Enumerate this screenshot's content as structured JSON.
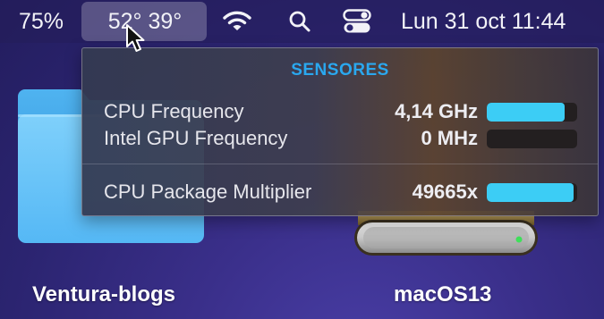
{
  "menubar": {
    "battery_percent": "75%",
    "temperatures": "52° 39°",
    "icons": {
      "wifi": "wifi-icon",
      "search": "search-icon",
      "control_center": "control-center-icon"
    },
    "clock": "Lun 31 oct 11:44"
  },
  "popover": {
    "title": "SENSORES",
    "accent_color": "#2aa8ef",
    "bar_color": "#3ccdf5",
    "sensors": [
      {
        "name": "CPU Frequency",
        "value": "4,14 GHz",
        "level": 0.86
      },
      {
        "name": "Intel GPU Frequency",
        "value": "0 MHz",
        "level": 0.0
      },
      {
        "name": "CPU Package Multiplier",
        "value": "49665x",
        "level": 0.96
      }
    ]
  },
  "desktop": {
    "items": [
      {
        "label": "Ventura-blogs",
        "icon": "folder-icon"
      },
      {
        "label": "macOS13",
        "icon": "hard-disk-icon"
      }
    ]
  }
}
